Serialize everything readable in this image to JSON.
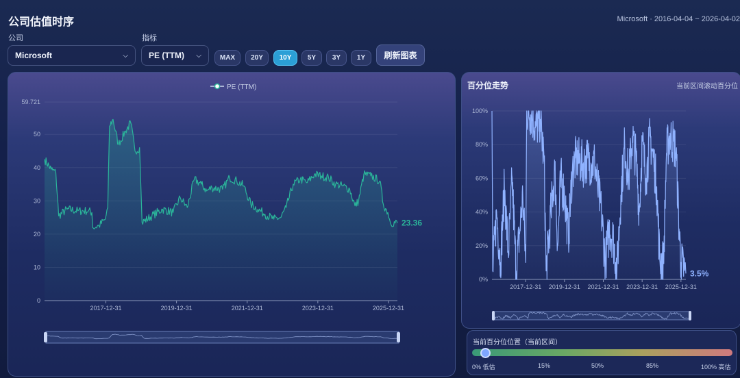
{
  "header": {
    "title": "公司估值时序",
    "range_info": "Microsoft · 2016-04-04 ~ 2026-04-02"
  },
  "controls": {
    "company_label": "公司",
    "company_value": "Microsoft",
    "metric_label": "指标",
    "metric_value": "PE (TTM)",
    "ranges": [
      "MAX",
      "20Y",
      "10Y",
      "5Y",
      "3Y",
      "1Y"
    ],
    "active_range": "10Y",
    "refresh_label": "刷新图表"
  },
  "colors": {
    "pe_line": "#2bb59a",
    "pct_line": "#8fb2ff",
    "active_button": "#2b9fd6"
  },
  "chart_data": [
    {
      "type": "line",
      "series": [
        {
          "name": "PE (TTM)",
          "anchors": [
            [
              2016.26,
              42.5
            ],
            [
              2016.45,
              39.5
            ],
            [
              2016.58,
              38.5
            ],
            [
              2016.66,
              25.5
            ],
            [
              2016.9,
              27.5
            ],
            [
              2017.2,
              27.0
            ],
            [
              2017.5,
              27.0
            ],
            [
              2017.6,
              26.5
            ],
            [
              2017.62,
              22.0
            ],
            [
              2017.8,
              22.5
            ],
            [
              2017.98,
              24.5
            ],
            [
              2018.05,
              28.0
            ],
            [
              2018.1,
              52.5
            ],
            [
              2018.2,
              54.5
            ],
            [
              2018.35,
              47.0
            ],
            [
              2018.55,
              51.0
            ],
            [
              2018.7,
              53.5
            ],
            [
              2018.82,
              45.0
            ],
            [
              2018.95,
              46.0
            ],
            [
              2019.0,
              30.0
            ],
            [
              2019.02,
              23.5
            ],
            [
              2019.3,
              25.5
            ],
            [
              2019.6,
              27.5
            ],
            [
              2019.9,
              26.5
            ],
            [
              2020.1,
              31.0
            ],
            [
              2020.3,
              28.0
            ],
            [
              2020.5,
              36.5
            ],
            [
              2020.7,
              35.0
            ],
            [
              2020.85,
              33.0
            ],
            [
              2021.0,
              34.0
            ],
            [
              2021.3,
              33.5
            ],
            [
              2021.5,
              37.0
            ],
            [
              2021.7,
              36.0
            ],
            [
              2021.9,
              34.5
            ],
            [
              2022.1,
              29.0
            ],
            [
              2022.3,
              27.5
            ],
            [
              2022.5,
              26.0
            ],
            [
              2022.75,
              24.5
            ],
            [
              2022.95,
              25.0
            ],
            [
              2023.1,
              28.0
            ],
            [
              2023.3,
              35.0
            ],
            [
              2023.5,
              36.5
            ],
            [
              2023.7,
              35.5
            ],
            [
              2023.9,
              38.0
            ],
            [
              2024.1,
              37.5
            ],
            [
              2024.3,
              37.0
            ],
            [
              2024.5,
              35.0
            ],
            [
              2024.7,
              34.5
            ],
            [
              2024.9,
              33.5
            ],
            [
              2025.05,
              28.5
            ],
            [
              2025.15,
              30.0
            ],
            [
              2025.3,
              38.0
            ],
            [
              2025.5,
              37.5
            ],
            [
              2025.75,
              36.0
            ],
            [
              2025.85,
              29.0
            ],
            [
              2025.98,
              26.5
            ],
            [
              2026.05,
              23.5
            ],
            [
              2026.25,
              23.36
            ]
          ]
        }
      ],
      "last_value_label": "23.36",
      "x_ticks": [
        "2017-12-31",
        "2019-12-31",
        "2021-12-31",
        "2023-12-31",
        "2025-12-31"
      ],
      "y_ticks": [
        "0",
        "10",
        "20",
        "30",
        "40",
        "50"
      ],
      "y_max_label": "59.721",
      "ylim": [
        0,
        59.721
      ],
      "legend": "top-center",
      "grid": true
    },
    {
      "type": "line",
      "title": "百分位走势",
      "subtitle": "当前区间滚动百分位",
      "series": [
        {
          "name": "百分位",
          "anchors": [
            [
              2016.26,
              100
            ],
            [
              2016.3,
              5
            ],
            [
              2016.5,
              40
            ],
            [
              2016.7,
              10
            ],
            [
              2016.9,
              55
            ],
            [
              2017.1,
              15
            ],
            [
              2017.3,
              60
            ],
            [
              2017.5,
              5
            ],
            [
              2017.7,
              30
            ],
            [
              2017.85,
              50
            ],
            [
              2018.0,
              10
            ],
            [
              2018.05,
              100
            ],
            [
              2018.3,
              98
            ],
            [
              2018.5,
              90
            ],
            [
              2018.75,
              95
            ],
            [
              2018.95,
              70
            ],
            [
              2019.05,
              5
            ],
            [
              2019.3,
              40
            ],
            [
              2019.5,
              65
            ],
            [
              2019.65,
              20
            ],
            [
              2019.8,
              60
            ],
            [
              2020.0,
              50
            ],
            [
              2020.2,
              25
            ],
            [
              2020.4,
              65
            ],
            [
              2020.6,
              72
            ],
            [
              2020.8,
              70
            ],
            [
              2021.0,
              68
            ],
            [
              2021.2,
              72
            ],
            [
              2021.4,
              68
            ],
            [
              2021.55,
              70
            ],
            [
              2021.7,
              55
            ],
            [
              2021.9,
              40
            ],
            [
              2022.1,
              10
            ],
            [
              2022.3,
              30
            ],
            [
              2022.5,
              25
            ],
            [
              2022.7,
              5
            ],
            [
              2022.9,
              50
            ],
            [
              2023.1,
              80
            ],
            [
              2023.3,
              60
            ],
            [
              2023.5,
              85
            ],
            [
              2023.7,
              70
            ],
            [
              2023.85,
              40
            ],
            [
              2024.0,
              82
            ],
            [
              2024.2,
              60
            ],
            [
              2024.4,
              85
            ],
            [
              2024.6,
              70
            ],
            [
              2024.75,
              55
            ],
            [
              2024.9,
              12
            ],
            [
              2025.1,
              10
            ],
            [
              2025.25,
              75
            ],
            [
              2025.4,
              85
            ],
            [
              2025.6,
              82
            ],
            [
              2025.75,
              75
            ],
            [
              2025.9,
              30
            ],
            [
              2026.0,
              10
            ],
            [
              2026.25,
              3.5
            ]
          ]
        }
      ],
      "last_value_label": "3.5%",
      "x_ticks": [
        "2017-12-31",
        "2019-12-31",
        "2021-12-31",
        "2023-12-31",
        "2025-12-31"
      ],
      "y_ticks": [
        "0%",
        "20%",
        "40%",
        "60%",
        "80%",
        "100%"
      ],
      "ylim": [
        0,
        100
      ],
      "grid": true
    }
  ],
  "gauge": {
    "title": "当前百分位位置（当前区间）",
    "value": 3.5,
    "ticks": [
      "0% 低估",
      "15%",
      "50%",
      "85%",
      "100% 高估"
    ]
  }
}
